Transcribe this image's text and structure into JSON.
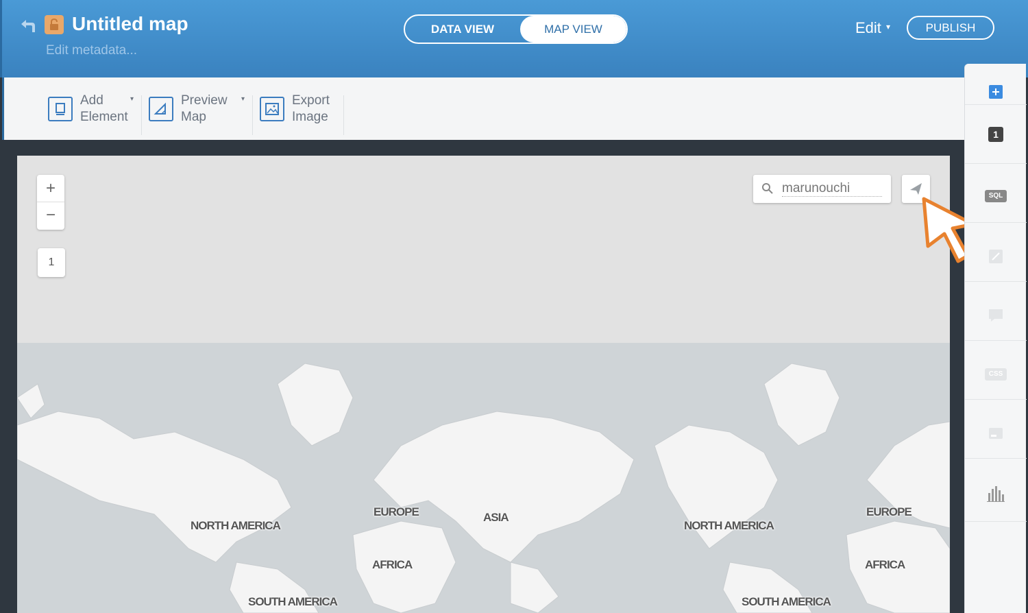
{
  "header": {
    "title": "Untitled map",
    "edit_metadata": "Edit metadata...",
    "tabs": [
      {
        "label": "DATA VIEW",
        "active": false
      },
      {
        "label": "MAP VIEW",
        "active": true
      }
    ],
    "edit_menu": "Edit",
    "publish": "PUBLISH"
  },
  "toolbar": {
    "add_element": {
      "line1": "Add",
      "line2": "Element"
    },
    "preview_map": {
      "line1": "Preview",
      "line2": "Map"
    },
    "export_image": {
      "line1": "Export",
      "line2": "Image"
    }
  },
  "map": {
    "zoom_in": "+",
    "zoom_out": "−",
    "layer_count": "1",
    "search_value": "marunouchi",
    "labels": [
      "NORTH AMERICA",
      "EUROPE",
      "ASIA",
      "AFRICA",
      "SOUTH AMERICA",
      "NORTH AMERICA",
      "EUROPE",
      "AFRICA",
      "SOUTH AMERICA"
    ]
  },
  "sidebar": {
    "layer_number": "1",
    "sql_label": "SQL",
    "css_label": "CSS",
    "icons": [
      "add-layer-icon",
      "layer-1-icon",
      "sql-icon",
      "wizard-icon",
      "infowindow-icon",
      "css-icon",
      "legend-icon",
      "chart-icon"
    ]
  },
  "colors": {
    "header": "#3a82bf",
    "accent": "#3b7cbf",
    "cursor": "#e8822f"
  }
}
